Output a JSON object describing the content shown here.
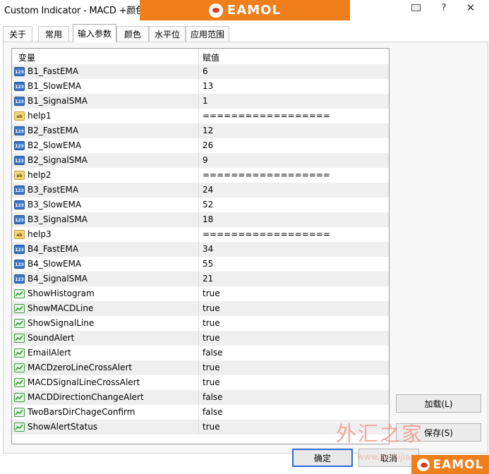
{
  "window": {
    "title": "Custom Indicator - MACD +颜色 -",
    "brand": "EAMOL",
    "help_glyph": "?",
    "close_glyph": "✕"
  },
  "tabs": [
    {
      "label": "关于"
    },
    {
      "label": "常用"
    },
    {
      "label": "输入参数",
      "active": true
    },
    {
      "label": "颜色"
    },
    {
      "label": "水平位"
    },
    {
      "label": "应用范围"
    }
  ],
  "grid": {
    "col_variable": "变量",
    "col_value": "赋值",
    "rows": [
      {
        "icon": "num",
        "name": "B1_FastEMA",
        "value": "6"
      },
      {
        "icon": "num",
        "name": "B1_SlowEMA",
        "value": "13"
      },
      {
        "icon": "num",
        "name": "B1_SignalSMA",
        "value": "1"
      },
      {
        "icon": "str",
        "name": "help1",
        "value": "=================="
      },
      {
        "icon": "num",
        "name": "B2_FastEMA",
        "value": "12"
      },
      {
        "icon": "num",
        "name": "B2_SlowEMA",
        "value": "26"
      },
      {
        "icon": "num",
        "name": "B2_SignalSMA",
        "value": "9"
      },
      {
        "icon": "str",
        "name": "help2",
        "value": "=================="
      },
      {
        "icon": "num",
        "name": "B3_FastEMA",
        "value": "24"
      },
      {
        "icon": "num",
        "name": "B3_SlowEMA",
        "value": "52"
      },
      {
        "icon": "num",
        "name": "B3_SignalSMA",
        "value": "18"
      },
      {
        "icon": "str",
        "name": "help3",
        "value": "=================="
      },
      {
        "icon": "num",
        "name": "B4_FastEMA",
        "value": "34"
      },
      {
        "icon": "num",
        "name": "B4_SlowEMA",
        "value": "55"
      },
      {
        "icon": "num",
        "name": "B4_SignalSMA",
        "value": "21"
      },
      {
        "icon": "bool",
        "name": "ShowHistogram",
        "value": "true"
      },
      {
        "icon": "bool",
        "name": "ShowMACDLine",
        "value": "true"
      },
      {
        "icon": "bool",
        "name": "ShowSignalLine",
        "value": "true"
      },
      {
        "icon": "bool",
        "name": "SoundAlert",
        "value": "true"
      },
      {
        "icon": "bool",
        "name": "EmailAlert",
        "value": "false"
      },
      {
        "icon": "bool",
        "name": "MACDzeroLineCrossAlert",
        "value": "true"
      },
      {
        "icon": "bool",
        "name": "MACDSignalLineCrossAlert",
        "value": "true"
      },
      {
        "icon": "bool",
        "name": "MACDDirectionChangeAlert",
        "value": "false"
      },
      {
        "icon": "bool",
        "name": "TwoBarsDirChageConfirm",
        "value": "false"
      },
      {
        "icon": "bool",
        "name": "ShowAlertStatus",
        "value": "true"
      }
    ]
  },
  "buttons": {
    "load": "加载(L)",
    "save": "保存(S)",
    "ok": "确定",
    "cancel": "取消"
  },
  "watermark": {
    "text": "外汇之家",
    "url": "www.eaihijia.com"
  },
  "colors": {
    "brand_orange": "#ef7f1a",
    "ok_border": "#2d6bd3"
  }
}
